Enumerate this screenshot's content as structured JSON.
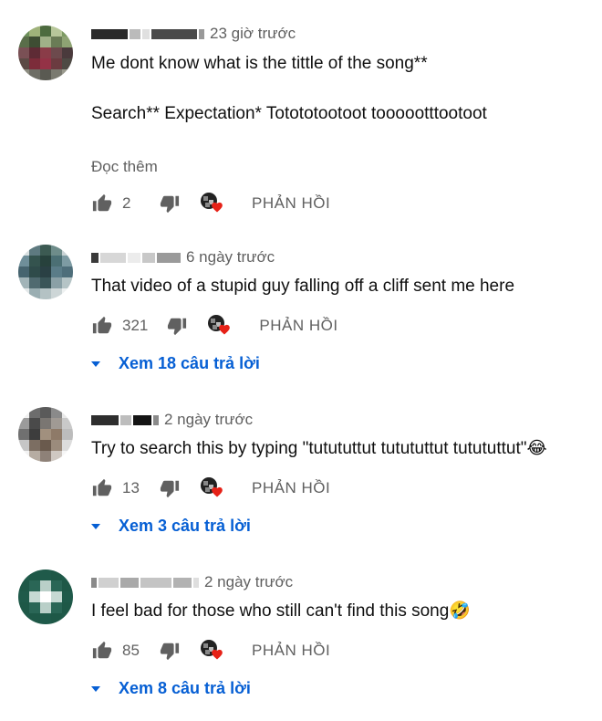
{
  "comments": [
    {
      "time": "23 giờ trước",
      "lines": [
        "Me dont know what is the tittle of the song**",
        "Search** Expectation* Totototootoot toooootttootoot"
      ],
      "read_more": "Đọc thêm",
      "likes": "2",
      "reply_label": "PHẢN HỒI",
      "replies_label": ""
    },
    {
      "time": "6 ngày trước",
      "lines": [
        "That video of a stupid guy falling off a cliff sent me here"
      ],
      "read_more": "",
      "likes": "321",
      "reply_label": "PHẢN HỒI",
      "replies_label": "Xem 18 câu trả lời"
    },
    {
      "time": "2 ngày trước",
      "lines": [
        "Try to search this by typing \"tutututtut tutututtut tutututtut\"😂"
      ],
      "read_more": "",
      "likes": "13",
      "reply_label": "PHẢN HỒI",
      "replies_label": "Xem 3 câu trả lời"
    },
    {
      "time": "2 ngày trước",
      "lines": [
        "I feel bad for those who still can't find this song🤣"
      ],
      "read_more": "",
      "likes": "85",
      "reply_label": "PHẢN HỒI",
      "replies_label": "Xem 8 câu trả lời"
    }
  ],
  "colors": {
    "link": "#065fd4",
    "secondary_text": "#606060",
    "heart": "#e62117"
  },
  "icons": [
    "like-icon",
    "dislike-icon",
    "creator-heart-icon",
    "caret-down-icon"
  ]
}
